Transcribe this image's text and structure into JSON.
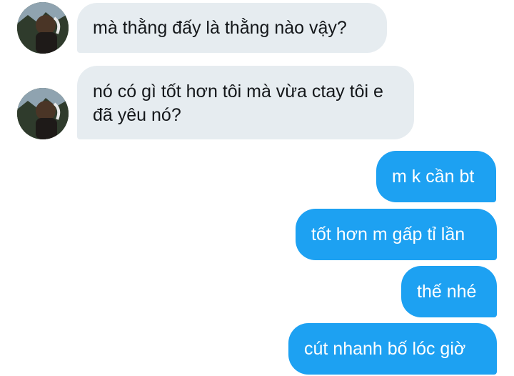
{
  "conversation": {
    "messages": [
      {
        "sender": "other",
        "avatar": "user-avatar",
        "text": "mà thằng đấy là thằng nào vậy?"
      },
      {
        "sender": "other",
        "avatar": "user-avatar",
        "text": "nó có gì tốt hơn tôi mà vừa ctay tôi e đã yêu nó?"
      },
      {
        "sender": "me",
        "text": "m k cần bt"
      },
      {
        "sender": "me",
        "text": "tốt hơn m gấp tỉ lần"
      },
      {
        "sender": "me",
        "text": "thế nhé"
      },
      {
        "sender": "me",
        "text": "cút nhanh bố lóc giờ"
      }
    ]
  },
  "colors": {
    "incoming_bubble": "#e6ecf0",
    "outgoing_bubble": "#1da1f2",
    "incoming_text": "#14171a",
    "outgoing_text": "#ffffff"
  }
}
